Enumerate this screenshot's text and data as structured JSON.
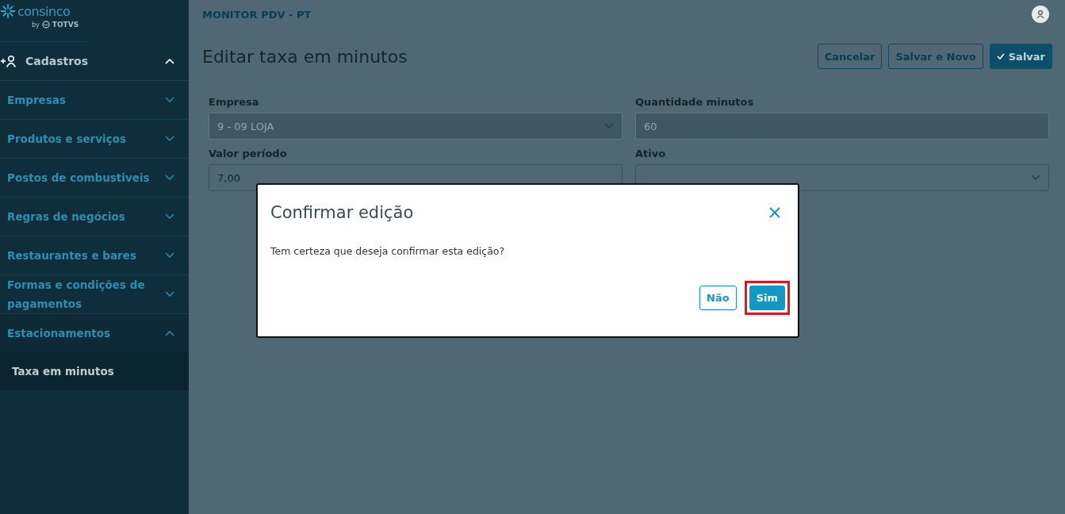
{
  "logo": {
    "name": "consinco",
    "byline": "by",
    "partner": "TOTVS"
  },
  "sidebar": {
    "section": {
      "label": "Cadastros",
      "expanded": true,
      "items": [
        {
          "label": "Empresas",
          "expanded": false
        },
        {
          "label": "Produtos e serviços",
          "expanded": false
        },
        {
          "label": "Postos de combustiveis",
          "expanded": false
        },
        {
          "label": "Regras de negócios",
          "expanded": false
        },
        {
          "label": "Restaurantes e bares",
          "expanded": false
        },
        {
          "label": "Formas e condições de pagamentos",
          "expanded": false
        },
        {
          "label": "Estacionamentos",
          "expanded": true,
          "children": [
            {
              "label": "Taxa em minutos",
              "selected": true
            }
          ]
        }
      ]
    }
  },
  "header": {
    "app_title": "MONITOR PDV - PT"
  },
  "page": {
    "title": "Editar taxa em minutos",
    "buttons": [
      {
        "label": "Cancelar",
        "kind": "outline"
      },
      {
        "label": "Salvar e Novo",
        "kind": "outline"
      },
      {
        "label": "Salvar",
        "kind": "primary"
      }
    ]
  },
  "form": {
    "fields": [
      {
        "label": "Empresa",
        "kind": "select",
        "value": "9 - 09 LOJA",
        "disabled": true
      },
      {
        "label": "Quantidade minutos",
        "kind": "text",
        "value": "60",
        "disabled": true
      },
      {
        "label": "Valor período",
        "kind": "text",
        "value": "7,00",
        "disabled": false
      },
      {
        "label": "Ativo",
        "kind": "select",
        "disabled": false
      }
    ]
  },
  "dialog": {
    "title": "Confirmar edição",
    "message": "Tem certeza que deseja confirmar esta edição?",
    "buttons": [
      {
        "label": "Não",
        "kind": "outline",
        "highlighted": false
      },
      {
        "label": "Sim",
        "kind": "primary",
        "highlighted": true
      }
    ]
  }
}
